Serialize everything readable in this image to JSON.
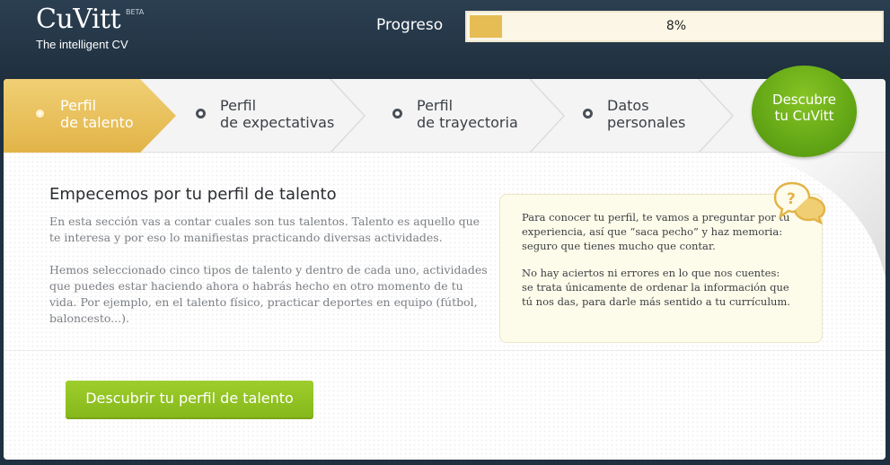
{
  "header": {
    "logo_text": "CuVitt",
    "logo_badge": "BETA",
    "logo_tagline": "The intelligent CV",
    "progress_label": "Progreso",
    "progress_value_text": "8%",
    "progress_fraction": 0.08
  },
  "steps": [
    {
      "line1": "Perfil",
      "line2": "de talento",
      "active": true
    },
    {
      "line1": "Perfil",
      "line2": "de expectativas",
      "active": false
    },
    {
      "line1": "Perfil",
      "line2": "de trayectoria",
      "active": false
    },
    {
      "line1": "Datos",
      "line2": "personales",
      "active": false
    }
  ],
  "cta": {
    "line1": "Descubre",
    "line2": "tu CuVitt"
  },
  "content": {
    "heading": "Empecemos por tu perfil de talento",
    "paragraph1": "En esta sección vas a contar cuales son tus talentos. Talento es aquello que te interesa y por eso lo manifiestas practicando diversas actividades.",
    "paragraph2": "Hemos seleccionado cinco tipos de talento y dentro de cada uno, actividades que puedes estar haciendo ahora o habrás hecho en otro momento de tu vida. Por ejemplo, en el talento físico, practicar deportes en equipo (fútbol, baloncesto...)."
  },
  "help": {
    "text1": "Para conocer tu perfil, te vamos a preguntar por tu experiencia, así que “saca pecho” y haz memoria: seguro que tienes mucho que contar.",
    "text2": "No hay aciertos ni errores en lo que nos cuentes: se trata únicamente de ordenar la información que tú nos das, para darle más sentido a tu currículum.",
    "icon": "question-bubble-icon"
  },
  "button": {
    "label": "Descubrir tu perfil de talento"
  },
  "colors": {
    "header_bg": "#243646",
    "accent_gold": "#e6bd55",
    "accent_green": "#86b81c",
    "help_bg": "#fdfbea"
  }
}
